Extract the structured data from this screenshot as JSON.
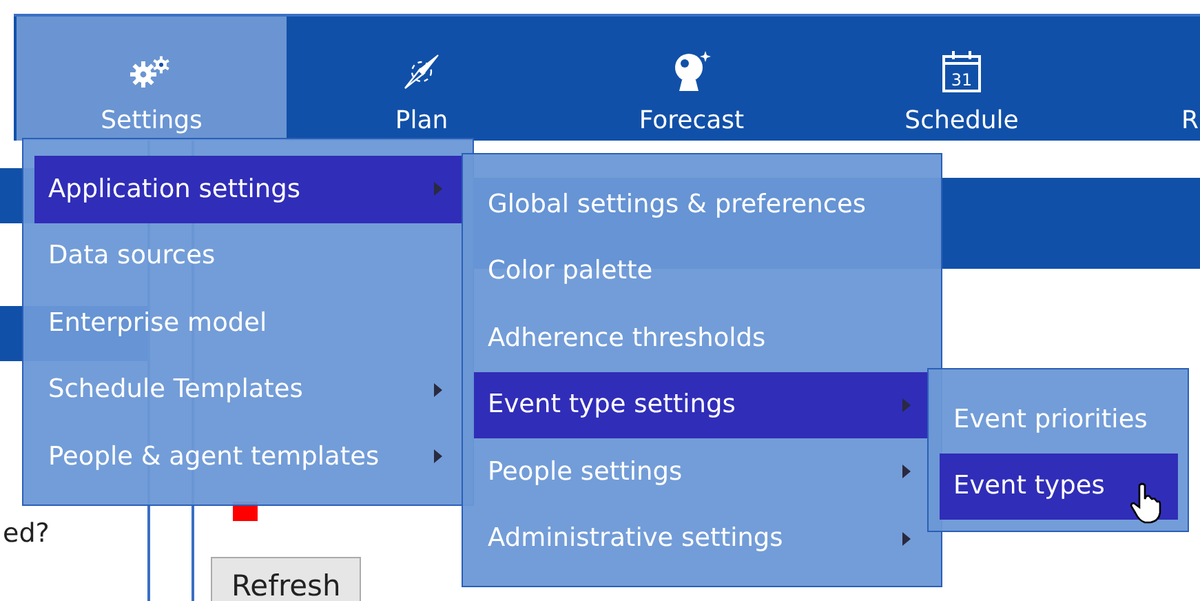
{
  "nav": {
    "items": [
      {
        "label": "Settings",
        "selected": true
      },
      {
        "label": "Plan",
        "selected": false
      },
      {
        "label": "Forecast",
        "selected": false
      },
      {
        "label": "Schedule",
        "selected": false,
        "icon_text": "31"
      },
      {
        "label": "R",
        "selected": false
      }
    ]
  },
  "page": {
    "question_fragment": "ed?",
    "refresh_button": "Refresh"
  },
  "menus": [
    {
      "items": [
        {
          "label": "Application settings",
          "selected": true,
          "has_submenu": true
        },
        {
          "label": "Data sources",
          "selected": false,
          "has_submenu": false
        },
        {
          "label": "Enterprise model",
          "selected": false,
          "has_submenu": false
        },
        {
          "label": "Schedule Templates",
          "selected": false,
          "has_submenu": true
        },
        {
          "label": "People & agent templates",
          "selected": false,
          "has_submenu": true
        }
      ]
    },
    {
      "items": [
        {
          "label": "Global settings & preferences",
          "selected": false,
          "has_submenu": false
        },
        {
          "label": "Color palette",
          "selected": false,
          "has_submenu": false
        },
        {
          "label": "Adherence thresholds",
          "selected": false,
          "has_submenu": false
        },
        {
          "label": "Event type settings",
          "selected": true,
          "has_submenu": true
        },
        {
          "label": "People settings",
          "selected": false,
          "has_submenu": true
        },
        {
          "label": "Administrative settings",
          "selected": false,
          "has_submenu": true
        }
      ]
    },
    {
      "items": [
        {
          "label": "Event priorities",
          "selected": false,
          "has_submenu": false
        },
        {
          "label": "Event types",
          "selected": true,
          "has_submenu": false
        }
      ]
    }
  ]
}
